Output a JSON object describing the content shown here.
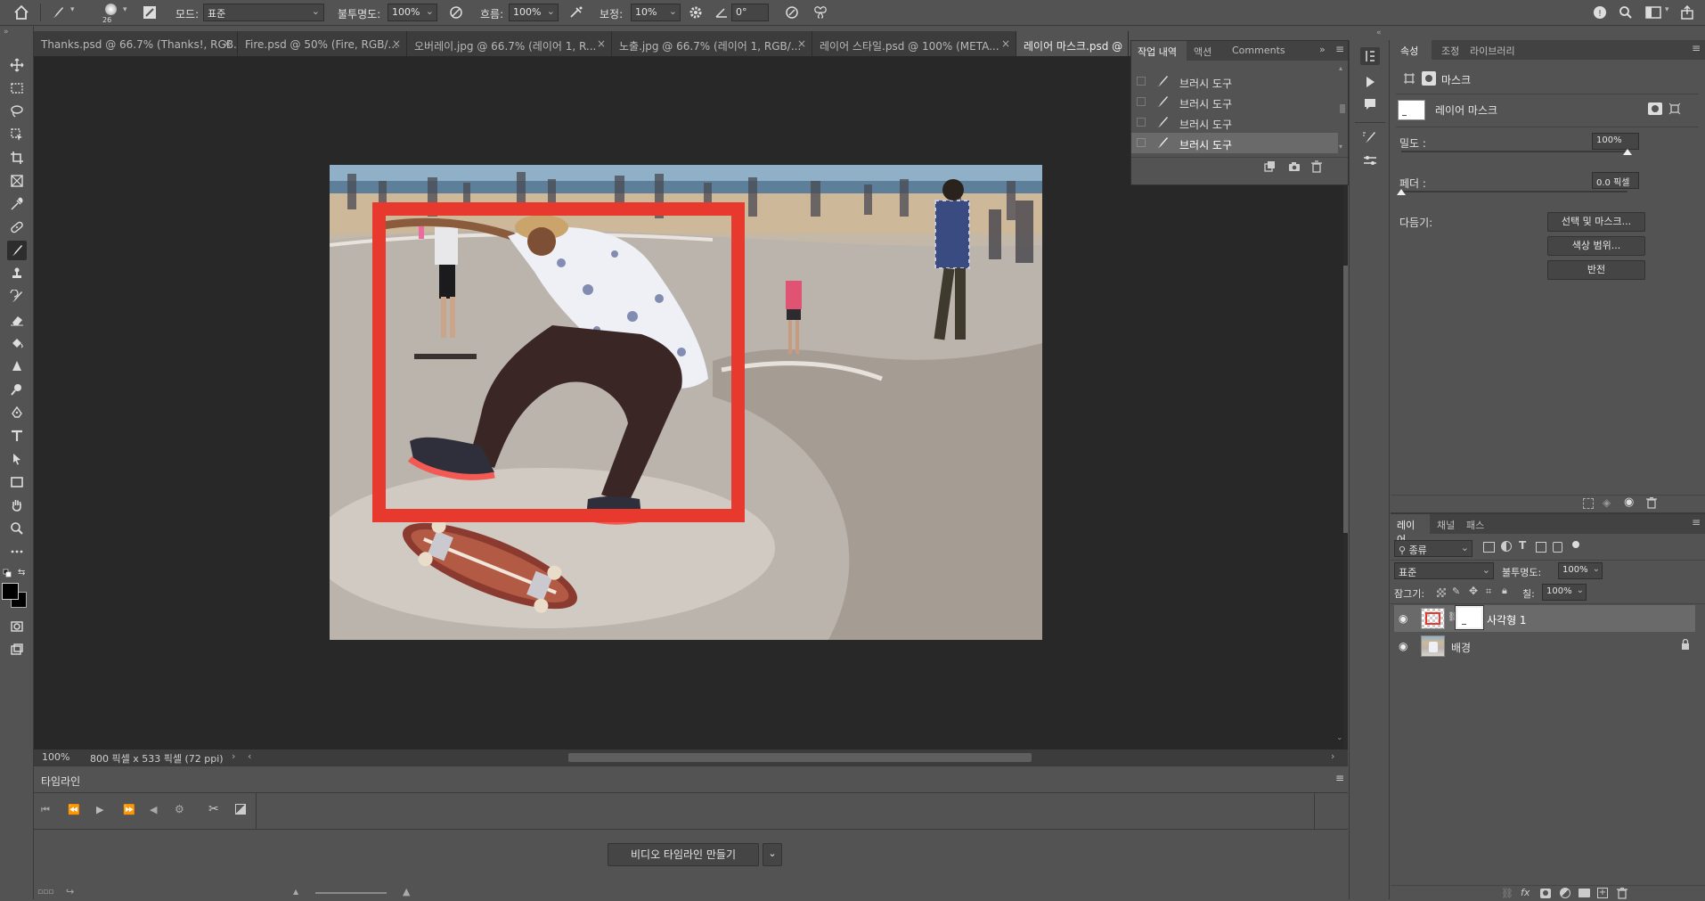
{
  "options": {
    "brush_size": "26",
    "mode_label": "모드:",
    "mode_value": "표준",
    "opacity_label": "불투명도:",
    "opacity_value": "100%",
    "flow_label": "흐름:",
    "flow_value": "100%",
    "smoothing_label": "보정:",
    "smoothing_value": "10%",
    "angle_value": "0°"
  },
  "tabs": [
    {
      "label": "Thanks.psd @ 66.7% (Thanks!, RGB..."
    },
    {
      "label": "Fire.psd @ 50% (Fire, RGB/..."
    },
    {
      "label": "오버레이.jpg @ 66.7% (레이어 1, R..."
    },
    {
      "label": "노출.jpg @ 66.7% (레이어 1, RGB/..."
    },
    {
      "label": "레이어 스타일.psd @ 100% (META..."
    },
    {
      "label": "레이어 마스크.psd @"
    }
  ],
  "history": {
    "tabs": [
      "작업 내역",
      "액션",
      "Comments"
    ],
    "items": [
      "브러시 도구",
      "브러시 도구",
      "브러시 도구",
      "브러시 도구"
    ]
  },
  "properties": {
    "tabs": [
      "속성",
      "조정",
      "라이브러리"
    ],
    "mask_title": "마스크",
    "layer_mask_label": "레이어 마스크",
    "density_label": "밀도 :",
    "density_value": "100%",
    "density_level": 1.0,
    "feather_label": "페더 :",
    "feather_value": "0.0 픽셀",
    "feather_level": 0.0,
    "refine_label": "다듬기:",
    "select_mask_button": "선택 및 마스크...",
    "color_range_button": "색상 범위...",
    "invert_button": "반전"
  },
  "layers": {
    "tabs": [
      "레이어",
      "채널",
      "패스"
    ],
    "filter_value": "종류",
    "blend_mode": "표준",
    "opacity_label": "불투명도:",
    "opacity_value": "100%",
    "lock_label": "잠그기:",
    "fill_label": "칠:",
    "fill_value": "100%",
    "items": [
      {
        "name": "사각형 1",
        "selected": true
      },
      {
        "name": "배경",
        "selected": false
      }
    ]
  },
  "status": {
    "zoom": "100%",
    "doc_size": "800 픽셀 x 533 픽셀 (72 ppi)"
  },
  "timeline": {
    "title": "타임라인",
    "create_button": "비디오 타임라인 만들기"
  },
  "colors": {
    "accent_red": "#e8392e",
    "panel_bg": "#535353",
    "canvas_bg": "#282828"
  }
}
